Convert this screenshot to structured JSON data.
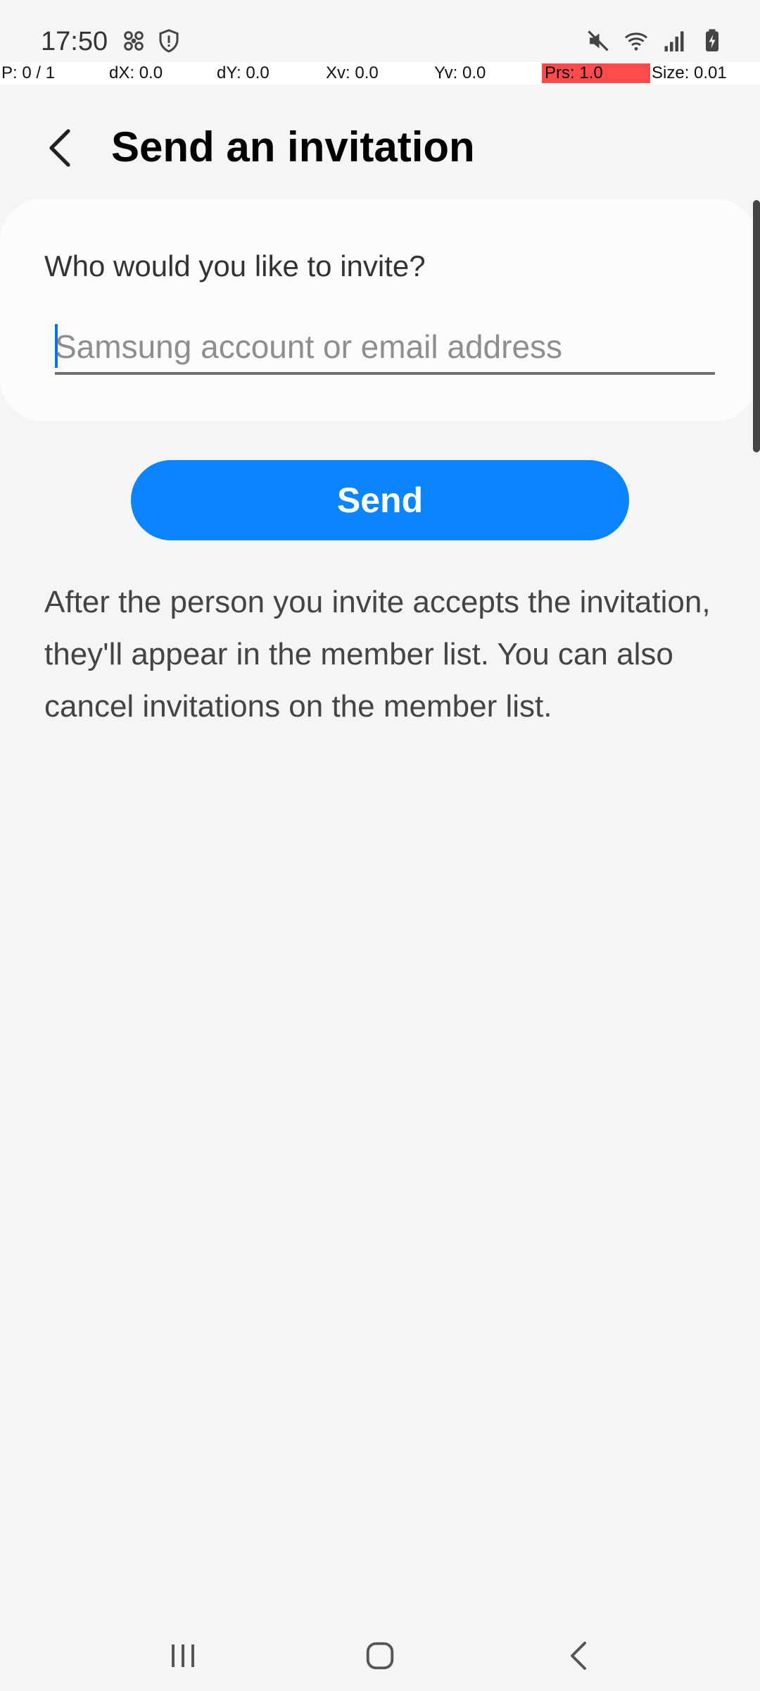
{
  "status_bar": {
    "time": "17:50",
    "left_icons": [
      "fan-icon",
      "shield-alert-icon"
    ],
    "right_icons": [
      "mute-icon",
      "wifi-icon",
      "signal-icon",
      "battery-charging-icon"
    ]
  },
  "pointer_overlay": {
    "p": "P: 0 / 1",
    "dx": "dX: 0.0",
    "dy": "dY: 0.0",
    "xv": "Xv: 0.0",
    "yv": "Yv: 0.0",
    "prs": "Prs: 1.0",
    "size": "Size: 0.01"
  },
  "header": {
    "title": "Send an invitation",
    "back_icon": "chevron-left-icon"
  },
  "invite_card": {
    "question": "Who would you like to invite?",
    "input_value": "",
    "input_placeholder": "Samsung account or email address"
  },
  "send_button": {
    "label": "Send"
  },
  "info": {
    "text": "After the person you invite accepts the invitation, they'll appear in the member list. You can also cancel invitations on the member list."
  },
  "nav_bar": {
    "recents_icon": "recents-icon",
    "home_icon": "home-icon",
    "back_icon": "back-icon"
  },
  "colors": {
    "accent": "#0a84ff",
    "background": "#f5f5f5",
    "card": "#fcfcfc"
  }
}
